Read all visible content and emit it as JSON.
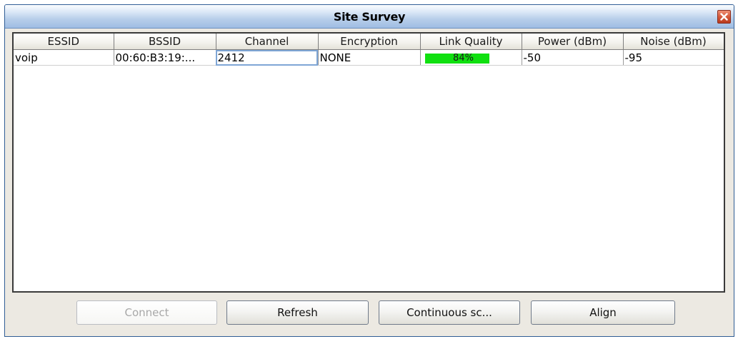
{
  "window": {
    "title": "Site Survey"
  },
  "table": {
    "columns": [
      "ESSID",
      "BSSID",
      "Channel",
      "Encryption",
      "Link Quality",
      "Power (dBm)",
      "Noise (dBm)"
    ],
    "rows": [
      {
        "essid": "voip",
        "bssid": "00:60:B3:19:...",
        "channel": "2412",
        "encryption": "NONE",
        "link_quality_text": "84%",
        "link_quality_value": 84,
        "power": "-50",
        "noise": "-95"
      }
    ]
  },
  "buttons": {
    "connect": "Connect",
    "refresh": "Refresh",
    "continuous": "Continuous sc...",
    "align": "Align"
  },
  "colors": {
    "quality_bar": "#10e010",
    "selection_outline": "#7fa6d6"
  }
}
